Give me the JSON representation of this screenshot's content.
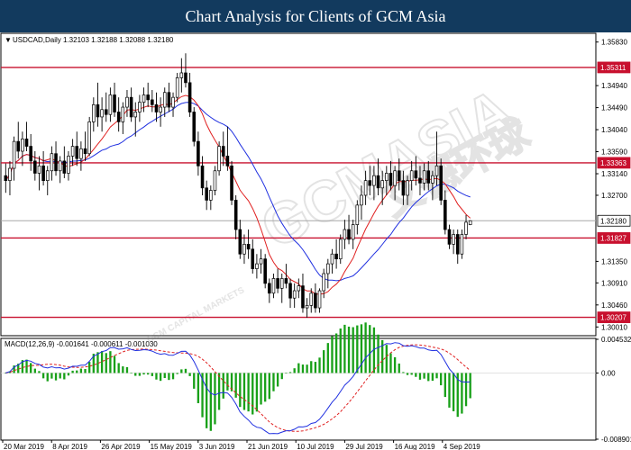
{
  "header": {
    "title": "Chart Analysis for Clients of GCM Asia"
  },
  "watermark": {
    "main": "GCMASIA",
    "cn": "艾德环球",
    "sub": "GCM CAPITAL MARKETS"
  },
  "chart_data": [
    {
      "type": "candlestick",
      "symbol_line": "USDCAD,Daily  1.32103 1.32188 1.32088 1.32180",
      "y_ticks": [
        "1.35830",
        "1.34940",
        "1.34490",
        "1.34040",
        "1.33590",
        "1.33140",
        "1.32700",
        "1.31350",
        "1.30910",
        "1.30460",
        "1.30010"
      ],
      "ylim": [
        1.2985,
        1.3599
      ],
      "x_ticks": [
        "20 Mar 2019",
        "8 Apr 2019",
        "26 Apr 2019",
        "15 May 2019",
        "3 Jun 2019",
        "21 Jun 2019",
        "10 Jul 2019",
        "29 Jul 2019",
        "16 Aug 2019",
        "4 Sep 2019"
      ],
      "levels": [
        {
          "value": 1.35311,
          "label": "1.35311"
        },
        {
          "value": 1.33363,
          "label": "1.33363"
        },
        {
          "value": 1.31827,
          "label": "1.31827"
        },
        {
          "value": 1.30207,
          "label": "1.30207"
        }
      ],
      "current": {
        "value": 1.3218,
        "label": "1.32180"
      },
      "candles": [
        [
          1.331,
          1.3335,
          1.3275,
          1.33
        ],
        [
          1.33,
          1.334,
          1.327,
          1.3325
        ],
        [
          1.3325,
          1.339,
          1.33,
          1.338
        ],
        [
          1.338,
          1.342,
          1.3345,
          1.336
        ],
        [
          1.336,
          1.34,
          1.333,
          1.3385
        ],
        [
          1.3385,
          1.342,
          1.336,
          1.337
        ],
        [
          1.337,
          1.3395,
          1.332,
          1.334
        ],
        [
          1.334,
          1.336,
          1.33,
          1.3315
        ],
        [
          1.3315,
          1.335,
          1.328,
          1.333
        ],
        [
          1.333,
          1.336,
          1.329,
          1.33
        ],
        [
          1.33,
          1.333,
          1.327,
          1.332
        ],
        [
          1.332,
          1.337,
          1.33,
          1.3355
        ],
        [
          1.3355,
          1.338,
          1.331,
          1.332
        ],
        [
          1.332,
          1.335,
          1.3295,
          1.334
        ],
        [
          1.334,
          1.337,
          1.3305,
          1.3315
        ],
        [
          1.3315,
          1.336,
          1.33,
          1.335
        ],
        [
          1.335,
          1.3385,
          1.333,
          1.337
        ],
        [
          1.337,
          1.34,
          1.333,
          1.3345
        ],
        [
          1.3345,
          1.338,
          1.332,
          1.3365
        ],
        [
          1.3365,
          1.34,
          1.334,
          1.3355
        ],
        [
          1.3355,
          1.343,
          1.335,
          1.342
        ],
        [
          1.342,
          1.347,
          1.34,
          1.3455
        ],
        [
          1.3455,
          1.35,
          1.341,
          1.343
        ],
        [
          1.343,
          1.347,
          1.34,
          1.3445
        ],
        [
          1.3445,
          1.348,
          1.342,
          1.3435
        ],
        [
          1.3435,
          1.349,
          1.342,
          1.3475
        ],
        [
          1.3475,
          1.35,
          1.343,
          1.344
        ],
        [
          1.344,
          1.347,
          1.34,
          1.342
        ],
        [
          1.342,
          1.346,
          1.3395,
          1.345
        ],
        [
          1.345,
          1.3485,
          1.343,
          1.347
        ],
        [
          1.347,
          1.349,
          1.342,
          1.343
        ],
        [
          1.343,
          1.346,
          1.339,
          1.344
        ],
        [
          1.344,
          1.3475,
          1.342,
          1.346
        ],
        [
          1.346,
          1.349,
          1.344,
          1.3475
        ],
        [
          1.3475,
          1.35,
          1.345,
          1.3465
        ],
        [
          1.3465,
          1.3485,
          1.344,
          1.3455
        ],
        [
          1.3455,
          1.348,
          1.342,
          1.344
        ],
        [
          1.344,
          1.347,
          1.341,
          1.345
        ],
        [
          1.345,
          1.349,
          1.343,
          1.348
        ],
        [
          1.348,
          1.35,
          1.344,
          1.345
        ],
        [
          1.345,
          1.348,
          1.343,
          1.347
        ],
        [
          1.347,
          1.352,
          1.346,
          1.351
        ],
        [
          1.351,
          1.355,
          1.348,
          1.352
        ],
        [
          1.352,
          1.356,
          1.349,
          1.35
        ],
        [
          1.35,
          1.352,
          1.343,
          1.344
        ],
        [
          1.344,
          1.345,
          1.337,
          1.338
        ],
        [
          1.338,
          1.34,
          1.331,
          1.333
        ],
        [
          1.333,
          1.335,
          1.327,
          1.3285
        ],
        [
          1.3285,
          1.33,
          1.324,
          1.326
        ],
        [
          1.326,
          1.329,
          1.324,
          1.328
        ],
        [
          1.328,
          1.333,
          1.327,
          1.332
        ],
        [
          1.332,
          1.338,
          1.331,
          1.337
        ],
        [
          1.337,
          1.34,
          1.333,
          1.335
        ],
        [
          1.335,
          1.341,
          1.332,
          1.333
        ],
        [
          1.333,
          1.334,
          1.325,
          1.326
        ],
        [
          1.326,
          1.327,
          1.318,
          1.32
        ],
        [
          1.32,
          1.322,
          1.314,
          1.315
        ],
        [
          1.315,
          1.319,
          1.313,
          1.317
        ],
        [
          1.317,
          1.32,
          1.314,
          1.316
        ],
        [
          1.316,
          1.318,
          1.311,
          1.312
        ],
        [
          1.312,
          1.315,
          1.31,
          1.313
        ],
        [
          1.313,
          1.316,
          1.311,
          1.314
        ],
        [
          1.314,
          1.315,
          1.308,
          1.309
        ],
        [
          1.309,
          1.31,
          1.305,
          1.307
        ],
        [
          1.307,
          1.311,
          1.306,
          1.31
        ],
        [
          1.31,
          1.312,
          1.307,
          1.308
        ],
        [
          1.308,
          1.311,
          1.305,
          1.31
        ],
        [
          1.31,
          1.313,
          1.308,
          1.309
        ],
        [
          1.309,
          1.31,
          1.304,
          1.306
        ],
        [
          1.306,
          1.309,
          1.304,
          1.3075
        ],
        [
          1.3075,
          1.31,
          1.306,
          1.3085
        ],
        [
          1.3085,
          1.311,
          1.303,
          1.304
        ],
        [
          1.304,
          1.306,
          1.302,
          1.3045
        ],
        [
          1.3045,
          1.308,
          1.303,
          1.307
        ],
        [
          1.307,
          1.309,
          1.303,
          1.304
        ],
        [
          1.304,
          1.308,
          1.303,
          1.3075
        ],
        [
          1.3075,
          1.312,
          1.306,
          1.311
        ],
        [
          1.311,
          1.314,
          1.308,
          1.313
        ],
        [
          1.313,
          1.316,
          1.311,
          1.315
        ],
        [
          1.315,
          1.318,
          1.312,
          1.314
        ],
        [
          1.314,
          1.319,
          1.313,
          1.318
        ],
        [
          1.318,
          1.322,
          1.316,
          1.32
        ],
        [
          1.32,
          1.323,
          1.317,
          1.318
        ],
        [
          1.318,
          1.322,
          1.316,
          1.321
        ],
        [
          1.321,
          1.326,
          1.319,
          1.325
        ],
        [
          1.325,
          1.329,
          1.322,
          1.327
        ],
        [
          1.327,
          1.332,
          1.325,
          1.33
        ],
        [
          1.33,
          1.333,
          1.327,
          1.329
        ],
        [
          1.329,
          1.333,
          1.326,
          1.331
        ],
        [
          1.331,
          1.3345,
          1.327,
          1.3285
        ],
        [
          1.3285,
          1.332,
          1.325,
          1.33
        ],
        [
          1.33,
          1.333,
          1.327,
          1.3315
        ],
        [
          1.3315,
          1.334,
          1.328,
          1.329
        ],
        [
          1.329,
          1.333,
          1.326,
          1.332
        ],
        [
          1.332,
          1.3345,
          1.328,
          1.33
        ],
        [
          1.33,
          1.332,
          1.325,
          1.327
        ],
        [
          1.327,
          1.331,
          1.325,
          1.33
        ],
        [
          1.33,
          1.334,
          1.328,
          1.332
        ],
        [
          1.332,
          1.335,
          1.329,
          1.3305
        ],
        [
          1.3305,
          1.333,
          1.327,
          1.3295
        ],
        [
          1.3295,
          1.3335,
          1.328,
          1.332
        ],
        [
          1.332,
          1.334,
          1.328,
          1.3295
        ],
        [
          1.3295,
          1.332,
          1.326,
          1.331
        ],
        [
          1.331,
          1.34,
          1.329,
          1.333
        ],
        [
          1.333,
          1.3345,
          1.325,
          1.326
        ],
        [
          1.326,
          1.328,
          1.319,
          1.32
        ],
        [
          1.32,
          1.321,
          1.316,
          1.317
        ],
        [
          1.317,
          1.32,
          1.315,
          1.319
        ],
        [
          1.319,
          1.32,
          1.313,
          1.315
        ],
        [
          1.315,
          1.32,
          1.314,
          1.319
        ],
        [
          1.319,
          1.323,
          1.318,
          1.3215
        ],
        [
          1.321,
          1.3219,
          1.3209,
          1.3218
        ]
      ],
      "sma_fast_color": "#e02020",
      "sma_slow_color": "#2030e0"
    },
    {
      "type": "macd",
      "label": "MACD(12,26,9) -0.001641 -0.000611 -0.001030",
      "y_ticks": [
        "0.004532",
        "0.00",
        "-0.008901"
      ],
      "ylim": [
        -0.008901,
        0.004532
      ],
      "histogram_color": "#18a018",
      "signal_color": "#e02020",
      "macd_color": "#2030e0"
    }
  ]
}
